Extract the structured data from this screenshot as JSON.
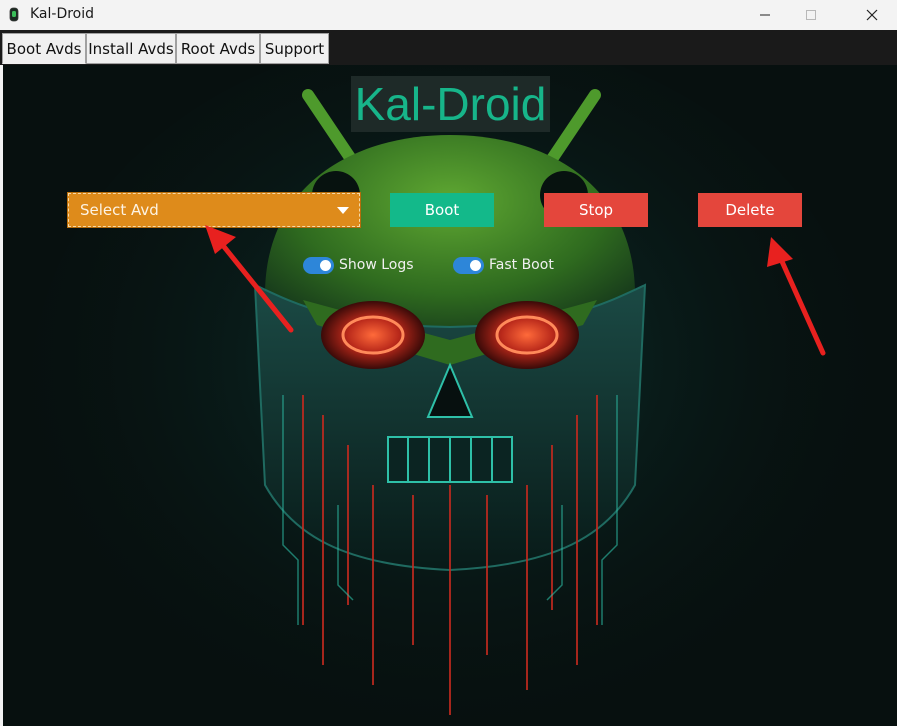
{
  "window": {
    "title": "Kal-Droid",
    "icon": "android-icon",
    "controls": [
      "minimize-icon",
      "maximize-icon",
      "close-icon"
    ]
  },
  "tabs": [
    {
      "label": "Boot Avds",
      "active": true
    },
    {
      "label": "Install Avds",
      "active": false
    },
    {
      "label": "Root Avds",
      "active": false
    },
    {
      "label": "Support",
      "active": false
    }
  ],
  "main": {
    "app_title": "Kal-Droid",
    "avd_select": {
      "value": "Select Avd"
    },
    "buttons": {
      "boot": "Boot",
      "stop": "Stop",
      "delete": "Delete"
    },
    "toggles": [
      {
        "label": "Show Logs",
        "on": true
      },
      {
        "label": "Fast Boot",
        "on": true
      }
    ]
  },
  "colors": {
    "title_text": "#17b58a",
    "select_bg": "#de8b1b",
    "boot_bg": "#13b98a",
    "danger_bg": "#e4463c",
    "toggle_on": "#2d86d9",
    "annotation_arrow": "#e8211f"
  }
}
